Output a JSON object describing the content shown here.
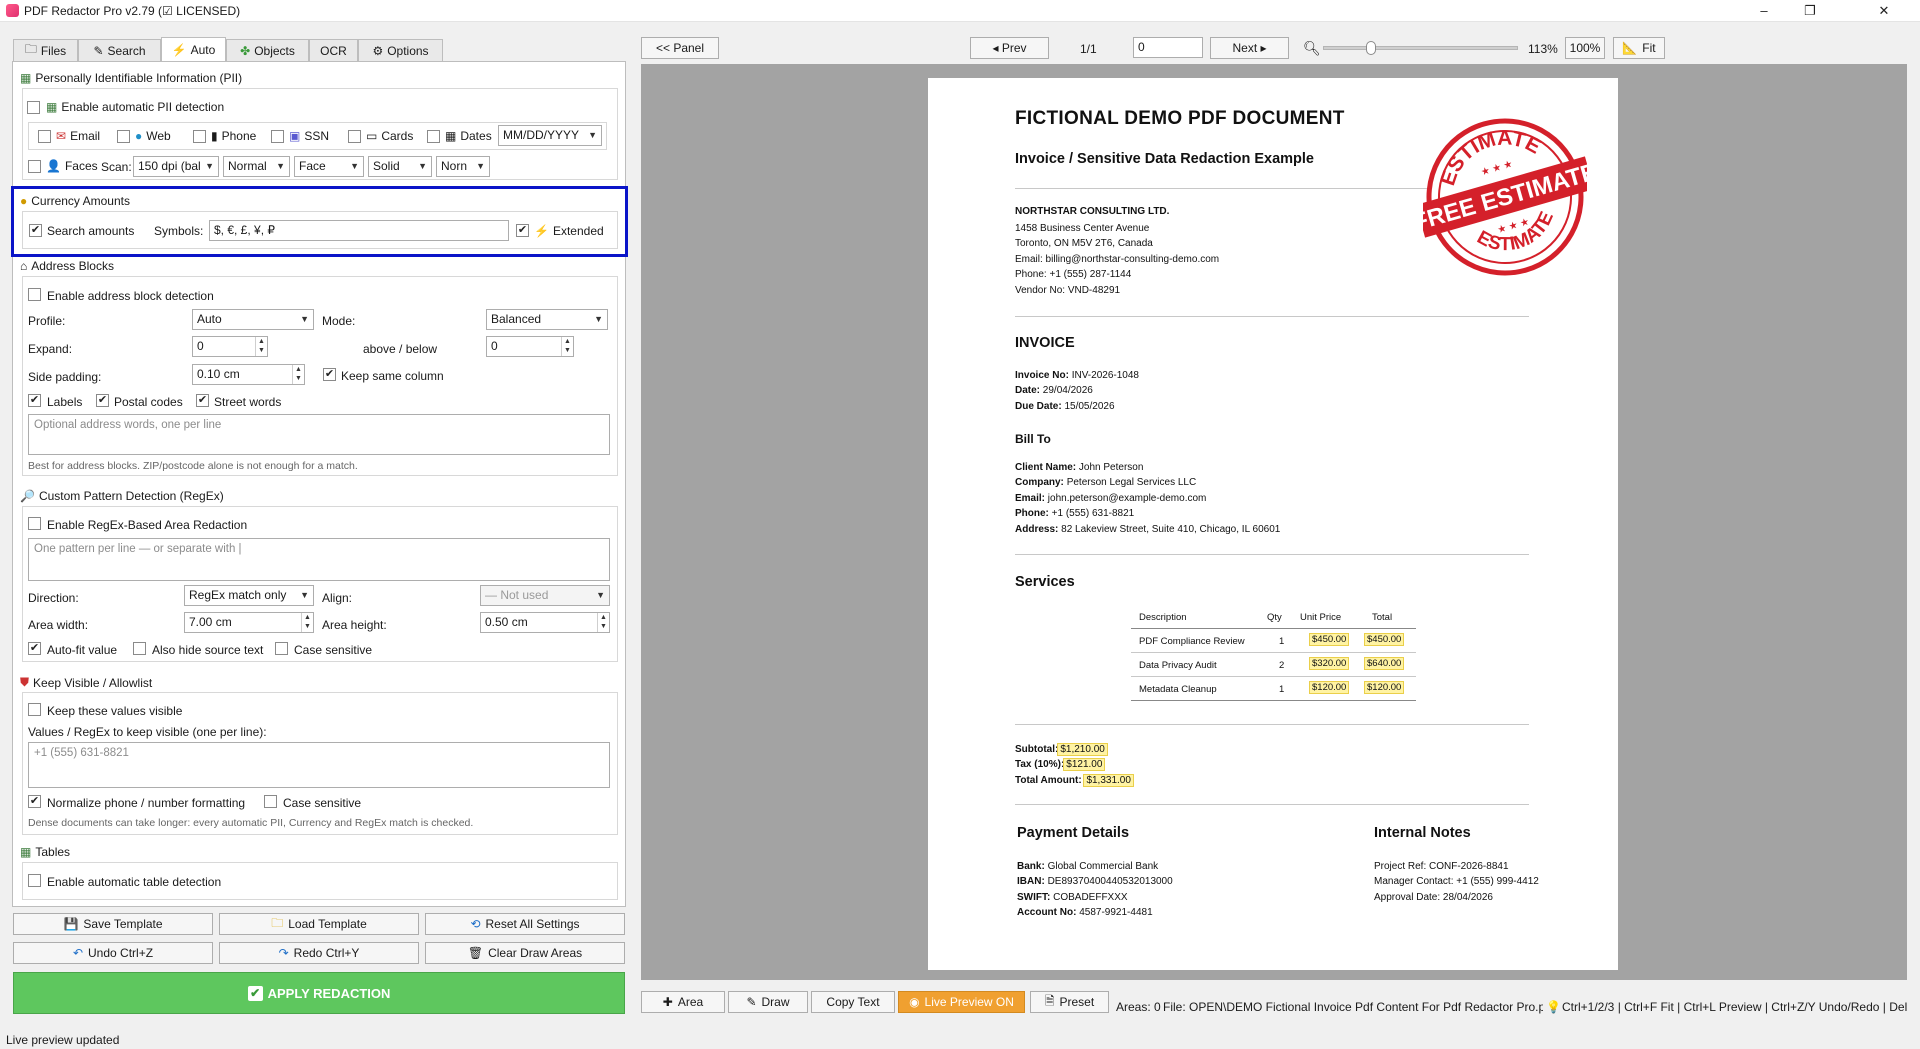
{
  "window": {
    "title": "PDF Redactor Pro v2.79 (☑ LICENSED)",
    "min": "–",
    "max": "❐",
    "close": "✕"
  },
  "tabs": [
    {
      "label": "Files"
    },
    {
      "label": "Search"
    },
    {
      "label": "Auto"
    },
    {
      "label": "Objects"
    },
    {
      "label": "OCR"
    },
    {
      "label": "Options"
    }
  ],
  "pii": {
    "title": "Personally Identifiable Information (PII)",
    "enable": "Enable automatic PII detection",
    "email": "Email",
    "web": "Web",
    "phone": "Phone",
    "ssn": "SSN",
    "cards": "Cards",
    "dates": "Dates",
    "date_format": "MM/DD/YYYY",
    "faces": "Faces",
    "scan_label": "Scan:",
    "scan_value": "150 dpi (bal",
    "mode_value": "Normal",
    "target_value": "Face",
    "fill_value": "Solid",
    "extra_value": "Norn"
  },
  "currency": {
    "title": "Currency Amounts",
    "search": "Search amounts",
    "search_checked": "✔",
    "symbols_label": "Symbols:",
    "symbols_value": "$, €, £, ¥, ₽",
    "extended": "Extended",
    "extended_checked": "✔",
    "highlight_color": "#0a14c8"
  },
  "address": {
    "title": "Address Blocks",
    "enable": "Enable address block detection",
    "profile_label": "Profile:",
    "profile_value": "Auto",
    "mode_label": "Mode:",
    "mode_value": "Balanced",
    "expand_label": "Expand:",
    "expand_value": "0",
    "above_below_label": "above / below",
    "above_below_value": "0",
    "side_padding_label": "Side padding:",
    "side_padding_value": "0.10 cm",
    "keep_column": "Keep same column",
    "labels": "Labels",
    "postal": "Postal codes",
    "street": "Street words",
    "words_placeholder": "Optional address words, one per line",
    "hint": "Best for address blocks. ZIP/postcode alone is not enough for a match."
  },
  "regex": {
    "title": "Custom Pattern Detection (RegEx)",
    "enable": "Enable RegEx-Based Area Redaction",
    "placeholder": "One pattern per line  —  or separate with |",
    "direction_label": "Direction:",
    "direction_value": "RegEx match only",
    "align_label": "Align:",
    "align_value": "— Not used",
    "width_label": "Area width:",
    "width_value": "7.00 cm",
    "height_label": "Area height:",
    "height_value": "0.50 cm",
    "autofit": "Auto-fit value",
    "hide_source": "Also hide source text",
    "case": "Case sensitive"
  },
  "allowlist": {
    "title": "Keep Visible / Allowlist",
    "enable": "Keep these values visible",
    "values_label": "Values / RegEx to keep visible (one per line):",
    "placeholder": "+1 (555) 631-8821",
    "normalize": "Normalize phone / number formatting",
    "case": "Case sensitive",
    "hint": "Dense documents can take longer: every automatic PII, Currency and RegEx match is checked."
  },
  "tables": {
    "title": "Tables",
    "enable": "Enable automatic table detection"
  },
  "buttons": {
    "save_template": "Save Template",
    "load_template": "Load Template",
    "reset": "Reset All Settings",
    "undo": "Undo  Ctrl+Z",
    "redo": "Redo  Ctrl+Y",
    "clear": "Clear Draw Areas",
    "apply": "APPLY REDACTION",
    "apply_color": "#5ec75e"
  },
  "status": "Live preview updated",
  "toolbar": {
    "panel": "<< Panel",
    "prev": "◂ Prev",
    "page_count": "1/1",
    "page_input": "0",
    "next": "Next ▸",
    "zoom_percent": "113%",
    "zoom_value": 0.113,
    "reset_zoom": "100%",
    "fit": "Fit"
  },
  "bottom": {
    "area": "Area",
    "draw": "Draw",
    "copy": "Copy Text",
    "live": "Live Preview ON",
    "preset": "Preset",
    "areas": "Areas: 0",
    "file": "File: OPEN\\DEMO Fictional Invoice Pdf Content For Pdf Redactor Pro.pd",
    "shortcuts": "Ctrl+1/2/3 | Ctrl+F Fit | Ctrl+L Preview | Ctrl+Z/Y Undo/Redo | Del",
    "live_color": "#f0a030"
  },
  "document": {
    "title": "FICTIONAL DEMO PDF DOCUMENT",
    "subtitle": "Invoice / Sensitive Data Redaction Example",
    "stamp_top": "ESTIMATE",
    "stamp_mid": "FREE ESTIMATE",
    "stamp_bottom": "ESTIMATE",
    "stamp_color": "#d4202a",
    "company": "NORTHSTAR CONSULTING LTD.",
    "company_lines": [
      "1458 Business Center Avenue",
      "Toronto, ON M5V 2T6, Canada",
      "Email: billing@northstar-consulting-demo.com",
      "Phone: +1 (555) 287-1144",
      "Vendor No: VND-48291"
    ],
    "invoice_heading": "INVOICE",
    "invoice_no_label": "Invoice No:",
    "invoice_no": "INV-2026-1048",
    "date_label": "Date:",
    "date": "29/04/2026",
    "due_label": "Due Date:",
    "due": "15/05/2026",
    "bill_to": "Bill To",
    "client_label": "Client Name:",
    "client": "John Peterson",
    "company_label": "Company:",
    "client_company": "Peterson Legal Services LLC",
    "email_label": "Email:",
    "email": "john.peterson@example-demo.com",
    "phone_label": "Phone:",
    "phone": "+1 (555) 631-8821",
    "address_label": "Address:",
    "address": "82 Lakeview Street, Suite 410, Chicago, IL 60601",
    "services_heading": "Services",
    "table_headers": [
      "Description",
      "Qty",
      "Unit Price",
      "Total"
    ],
    "table_rows": [
      {
        "desc": "PDF Compliance Review",
        "qty": "1",
        "unit": "$450.00",
        "total": "$450.00"
      },
      {
        "desc": "Data Privacy Audit",
        "qty": "2",
        "unit": "$320.00",
        "total": "$640.00"
      },
      {
        "desc": "Metadata Cleanup",
        "qty": "1",
        "unit": "$120.00",
        "total": "$120.00"
      }
    ],
    "subtotal_label": "Subtotal:",
    "subtotal": "$1,210.00",
    "tax_label": "Tax (10%):",
    "tax": "$121.00",
    "total_label": "Total Amount:",
    "total": "$1,331.00",
    "payment_heading": "Payment Details",
    "bank_label": "Bank:",
    "bank": "Global Commercial Bank",
    "iban_label": "IBAN:",
    "iban": "DE89370400440532013000",
    "swift_label": "SWIFT:",
    "swift": "COBADEFFXXX",
    "account_label": "Account No:",
    "account": "4587-9921-4481",
    "notes_heading": "Internal Notes",
    "notes_lines": [
      "Project Ref: CONF-2026-8841",
      "Manager Contact: +1 (555) 999-4412",
      "Approval Date: 28/04/2026"
    ]
  }
}
